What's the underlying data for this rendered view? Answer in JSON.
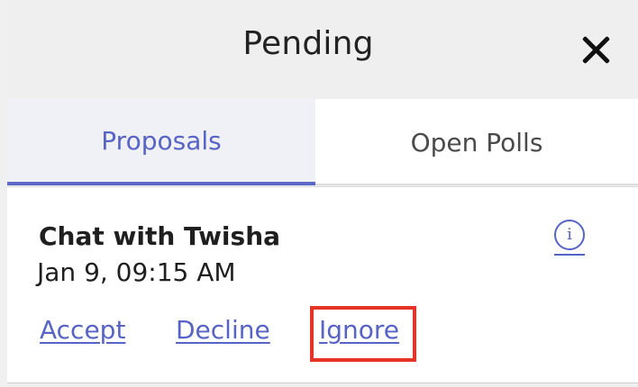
{
  "header": {
    "title": "Pending",
    "close_icon": "close-icon"
  },
  "tabs": [
    {
      "label": "Proposals",
      "active": true
    },
    {
      "label": "Open Polls",
      "active": false
    }
  ],
  "proposal": {
    "title": "Chat with Twisha",
    "time": "Jan 9, 09:15 AM",
    "info_icon": "info-icon",
    "actions": {
      "accept": "Accept",
      "decline": "Decline",
      "ignore": "Ignore"
    }
  },
  "colors": {
    "accent": "#5763c5",
    "highlight": "#e53427"
  }
}
